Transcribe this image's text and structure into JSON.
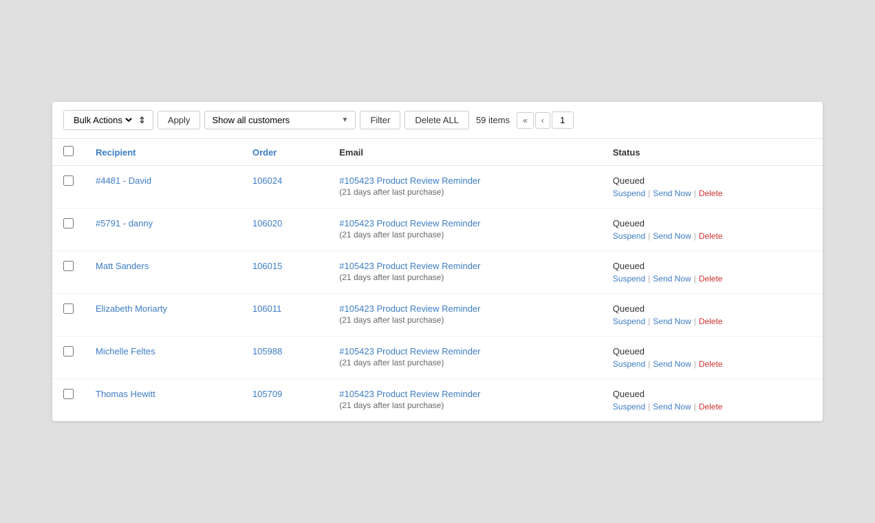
{
  "toolbar": {
    "bulk_actions_label": "Bulk Actions",
    "apply_label": "Apply",
    "filter_dropdown_label": "Show all customers",
    "filter_button_label": "Filter",
    "delete_all_label": "Delete ALL",
    "item_count": "59 items",
    "pagination": {
      "first_label": "«",
      "prev_label": "‹",
      "current_page": "1"
    }
  },
  "table": {
    "headers": {
      "recipient": "Recipient",
      "order": "Order",
      "email": "Email",
      "status": "Status"
    },
    "rows": [
      {
        "id": "row-1",
        "recipient": "#4481 - David",
        "order": "106024",
        "email_subject": "#105423 Product Review Reminder",
        "email_note": "(21 days after last purchase)",
        "status": "Queued",
        "actions": [
          "Suspend",
          "Send Now",
          "Delete"
        ]
      },
      {
        "id": "row-2",
        "recipient": "#5791 - danny",
        "order": "106020",
        "email_subject": "#105423 Product Review Reminder",
        "email_note": "(21 days after last purchase)",
        "status": "Queued",
        "actions": [
          "Suspend",
          "Send Now",
          "Delete"
        ]
      },
      {
        "id": "row-3",
        "recipient": "Matt Sanders",
        "order": "106015",
        "email_subject": "#105423 Product Review Reminder",
        "email_note": "(21 days after last purchase)",
        "status": "Queued",
        "actions": [
          "Suspend",
          "Send Now",
          "Delete"
        ]
      },
      {
        "id": "row-4",
        "recipient": "Elizabeth Moriarty",
        "order": "106011",
        "email_subject": "#105423 Product Review Reminder",
        "email_note": "(21 days after last purchase)",
        "status": "Queued",
        "actions": [
          "Suspend",
          "Send Now",
          "Delete"
        ]
      },
      {
        "id": "row-5",
        "recipient": "Michelle Feltes",
        "order": "105988",
        "email_subject": "#105423 Product Review Reminder",
        "email_note": "(21 days after last purchase)",
        "status": "Queued",
        "actions": [
          "Suspend",
          "Send Now",
          "Delete"
        ]
      },
      {
        "id": "row-6",
        "recipient": "Thomas Hewitt",
        "order": "105709",
        "email_subject": "#105423 Product Review Reminder",
        "email_note": "(21 days after last purchase)",
        "status": "Queued",
        "actions": [
          "Suspend",
          "Send Now",
          "Delete"
        ]
      }
    ]
  }
}
